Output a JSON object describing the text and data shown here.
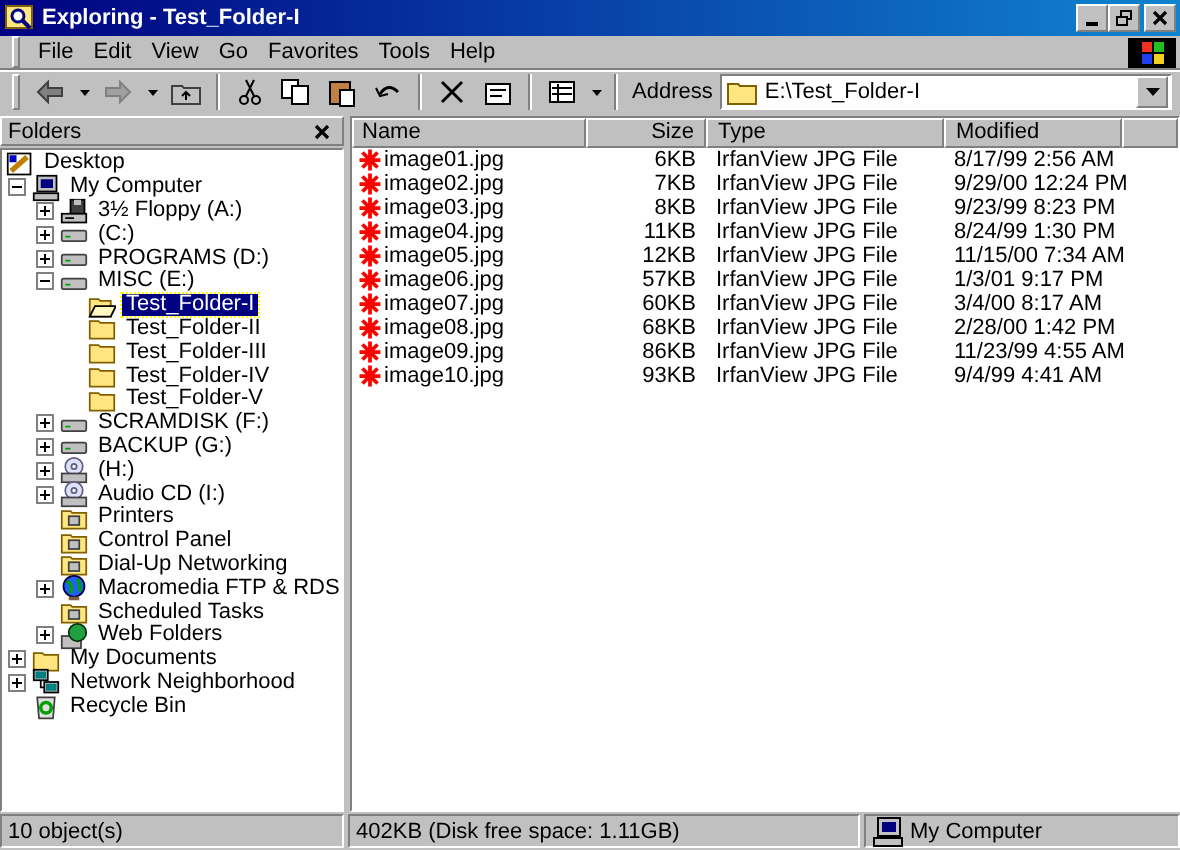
{
  "window": {
    "title": "Exploring - Test_Folder-I"
  },
  "menu": [
    "File",
    "Edit",
    "View",
    "Go",
    "Favorites",
    "Tools",
    "Help"
  ],
  "toolbar": {
    "buttons": [
      {
        "kind": "back"
      },
      {
        "kind": "dropdown"
      },
      {
        "kind": "forward"
      },
      {
        "kind": "dropdown"
      },
      {
        "kind": "up"
      },
      {
        "kind": "separator"
      },
      {
        "kind": "cut"
      },
      {
        "kind": "copy"
      },
      {
        "kind": "paste"
      },
      {
        "kind": "undo"
      },
      {
        "kind": "separator"
      },
      {
        "kind": "delete"
      },
      {
        "kind": "properties"
      },
      {
        "kind": "separator"
      },
      {
        "kind": "views"
      },
      {
        "kind": "dropdown"
      }
    ],
    "address_label": "Address",
    "address": "E:\\Test_Folder-I"
  },
  "folders_pane": {
    "title": "Folders",
    "tree": [
      {
        "label": "Desktop",
        "kind": "desktop",
        "expandable": false,
        "selected": false,
        "children": [
          {
            "label": "My Computer",
            "kind": "computer",
            "expandable": true,
            "expanded": true,
            "selected": false,
            "children": [
              {
                "label": "3½ Floppy (A:)",
                "kind": "floppy",
                "expandable": true,
                "expanded": false,
                "selected": false
              },
              {
                "label": "(C:)",
                "kind": "drive",
                "expandable": true,
                "expanded": false,
                "selected": false
              },
              {
                "label": "PROGRAMS (D:)",
                "kind": "drive",
                "expandable": true,
                "expanded": false,
                "selected": false
              },
              {
                "label": "MISC (E:)",
                "kind": "drive",
                "expandable": true,
                "expanded": true,
                "selected": false,
                "children": [
                  {
                    "label": "Test_Folder-I",
                    "kind": "open-folder",
                    "expandable": false,
                    "selected": true
                  },
                  {
                    "label": "Test_Folder-II",
                    "kind": "folder",
                    "expandable": false,
                    "selected": false
                  },
                  {
                    "label": "Test_Folder-III",
                    "kind": "folder",
                    "expandable": false,
                    "selected": false
                  },
                  {
                    "label": "Test_Folder-IV",
                    "kind": "folder",
                    "expandable": false,
                    "selected": false
                  },
                  {
                    "label": "Test_Folder-V",
                    "kind": "folder",
                    "expandable": false,
                    "selected": false
                  }
                ]
              },
              {
                "label": "SCRAMDISK (F:)",
                "kind": "drive",
                "expandable": true,
                "expanded": false,
                "selected": false
              },
              {
                "label": "BACKUP (G:)",
                "kind": "drive",
                "expandable": true,
                "expanded": false,
                "selected": false
              },
              {
                "label": "(H:)",
                "kind": "cdrom",
                "expandable": true,
                "expanded": false,
                "selected": false
              },
              {
                "label": "Audio CD (I:)",
                "kind": "cdrom",
                "expandable": true,
                "expanded": false,
                "selected": false
              },
              {
                "label": "Printers",
                "kind": "special-folder",
                "expandable": false,
                "selected": false
              },
              {
                "label": "Control Panel",
                "kind": "special-folder",
                "expandable": false,
                "selected": false
              },
              {
                "label": "Dial-Up Networking",
                "kind": "special-folder",
                "expandable": false,
                "selected": false
              },
              {
                "label": "Macromedia FTP & RDS",
                "kind": "globe",
                "expandable": true,
                "expanded": false,
                "selected": false
              },
              {
                "label": "Scheduled Tasks",
                "kind": "special-folder",
                "expandable": false,
                "selected": false
              },
              {
                "label": "Web Folders",
                "kind": "web",
                "expandable": true,
                "expanded": false,
                "selected": false
              }
            ]
          },
          {
            "label": "My Documents",
            "kind": "folder",
            "expandable": true,
            "expanded": false,
            "selected": false
          },
          {
            "label": "Network Neighborhood",
            "kind": "network",
            "expandable": true,
            "expanded": false,
            "selected": false
          },
          {
            "label": "Recycle Bin",
            "kind": "recycle",
            "expandable": false,
            "selected": false
          }
        ]
      }
    ]
  },
  "file_list": {
    "columns": [
      "Name",
      "Size",
      "Type",
      "Modified"
    ],
    "rows": [
      {
        "name": "image01.jpg",
        "size": "6KB",
        "type": "IrfanView JPG File",
        "modified": "8/17/99 2:56 AM"
      },
      {
        "name": "image02.jpg",
        "size": "7KB",
        "type": "IrfanView JPG File",
        "modified": "9/29/00 12:24 PM"
      },
      {
        "name": "image03.jpg",
        "size": "8KB",
        "type": "IrfanView JPG File",
        "modified": "9/23/99 8:23 PM"
      },
      {
        "name": "image04.jpg",
        "size": "11KB",
        "type": "IrfanView JPG File",
        "modified": "8/24/99 1:30 PM"
      },
      {
        "name": "image05.jpg",
        "size": "12KB",
        "type": "IrfanView JPG File",
        "modified": "11/15/00 7:34 AM"
      },
      {
        "name": "image06.jpg",
        "size": "57KB",
        "type": "IrfanView JPG File",
        "modified": "1/3/01 9:17 PM"
      },
      {
        "name": "image07.jpg",
        "size": "60KB",
        "type": "IrfanView JPG File",
        "modified": "3/4/00 8:17 AM"
      },
      {
        "name": "image08.jpg",
        "size": "68KB",
        "type": "IrfanView JPG File",
        "modified": "2/28/00 1:42 PM"
      },
      {
        "name": "image09.jpg",
        "size": "86KB",
        "type": "IrfanView JPG File",
        "modified": "11/23/99 4:55 AM"
      },
      {
        "name": "image10.jpg",
        "size": "93KB",
        "type": "IrfanView JPG File",
        "modified": "9/4/99 4:41 AM"
      }
    ]
  },
  "status_bar": {
    "objects": "10 object(s)",
    "size": "402KB (Disk free space: 1.11GB)",
    "zone": "My Computer"
  }
}
